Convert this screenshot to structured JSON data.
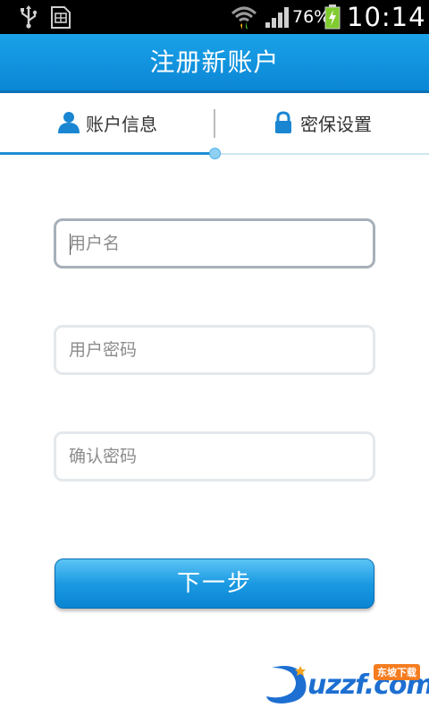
{
  "status_bar": {
    "battery_percent": "76%",
    "time": "10:14",
    "icons": [
      "usb-icon",
      "sd-card-icon",
      "wifi-icon",
      "signal-icon",
      "battery-charging-icon"
    ]
  },
  "header": {
    "title": "注册新账户"
  },
  "tabs": [
    {
      "label": "账户信息",
      "icon": "user-icon",
      "active": true
    },
    {
      "label": "密保设置",
      "icon": "lock-icon",
      "active": false
    }
  ],
  "progress": {
    "step": 1,
    "total": 2,
    "fraction": 0.5
  },
  "form": {
    "username": {
      "placeholder": "用户名",
      "value": ""
    },
    "password": {
      "placeholder": "用户密码",
      "value": ""
    },
    "confirm_password": {
      "placeholder": "确认密码",
      "value": ""
    }
  },
  "actions": {
    "next_label": "下一步"
  },
  "watermark": {
    "text": "uzzf.com",
    "badge": "东坡下载"
  },
  "colors": {
    "primary": "#0b86d5",
    "header_top": "#1aa2e8",
    "button_top": "#5cc4f6"
  }
}
